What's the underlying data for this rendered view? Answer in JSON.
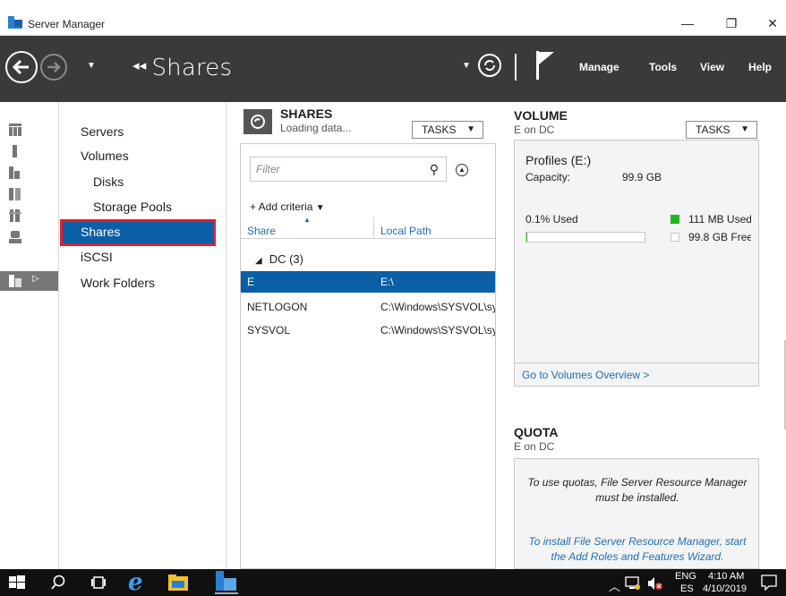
{
  "window": {
    "title": "Server Manager",
    "minimize": "—",
    "restore": "❐",
    "close": "✕"
  },
  "header": {
    "breadcrumb": "Shares",
    "menu": {
      "manage": "Manage",
      "tools": "Tools",
      "view": "View",
      "help": "Help"
    }
  },
  "nav": {
    "items": [
      "Servers",
      "Volumes",
      "Disks",
      "Storage Pools",
      "Shares",
      "iSCSI",
      "Work Folders"
    ],
    "selected": "Shares"
  },
  "shares": {
    "title": "SHARES",
    "status": "Loading data...",
    "tasks": "TASKS",
    "filter_placeholder": "Filter",
    "add_criteria": "+ Add criteria",
    "columns": [
      "Share",
      "Local Path"
    ],
    "group": "DC (3)",
    "rows": [
      {
        "share": "E",
        "path": "E:\\"
      },
      {
        "share": "NETLOGON",
        "path": "C:\\Windows\\SYSVOL\\sysvol\\"
      },
      {
        "share": "SYSVOL",
        "path": "C:\\Windows\\SYSVOL\\sysvol"
      }
    ],
    "selected_row": 0
  },
  "volume": {
    "title": "VOLUME",
    "subtitle": "E on DC",
    "tasks": "TASKS",
    "name": "Profiles (E:)",
    "capacity_label": "Capacity:",
    "capacity_value": "99.9 GB",
    "used_label": "0.1% Used",
    "used_fraction": 0.001,
    "used_legend": "111 MB Used",
    "free_legend": "99.8 GB Free",
    "link": "Go to Volumes Overview >",
    "colors": {
      "used": "#1fb81f",
      "free": "#ffffff"
    }
  },
  "quota": {
    "title": "QUOTA",
    "subtitle": "E on DC",
    "message1": "To use quotas, File Server Resource Manager must be installed.",
    "message2": "To install File Server Resource Manager, start the Add Roles and Features Wizard."
  },
  "taskbar": {
    "lang": "ENG",
    "layout": "ES",
    "time": "4:10 AM",
    "date": "4/10/2019"
  }
}
